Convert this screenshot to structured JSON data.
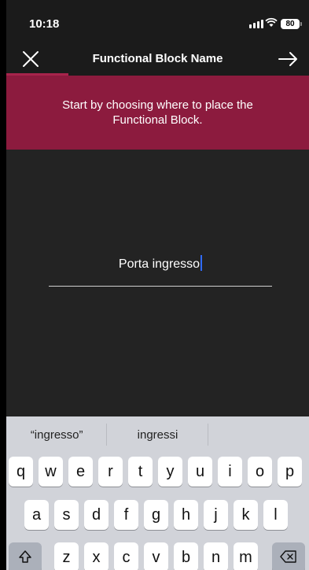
{
  "status_bar": {
    "time": "10:18",
    "battery": "80"
  },
  "nav": {
    "title": "Functional Block Name"
  },
  "banner": {
    "message": "Start by choosing where to place the Functional Block."
  },
  "name_input": {
    "value": "Porta ingresso"
  },
  "keyboard": {
    "suggestions": [
      "“ingresso”",
      "ingressi",
      ""
    ],
    "row1": [
      "q",
      "w",
      "e",
      "r",
      "t",
      "y",
      "u",
      "i",
      "o",
      "p"
    ],
    "row2": [
      "a",
      "s",
      "d",
      "f",
      "g",
      "h",
      "j",
      "k",
      "l"
    ],
    "row3": [
      "z",
      "x",
      "c",
      "v",
      "b",
      "n",
      "m"
    ],
    "shift_icon": "shift-icon",
    "delete_icon": "backspace-icon"
  },
  "colors": {
    "banner": "#8c1b3e",
    "tab_indicator": "#a8244c",
    "caret": "#2f6bff"
  }
}
